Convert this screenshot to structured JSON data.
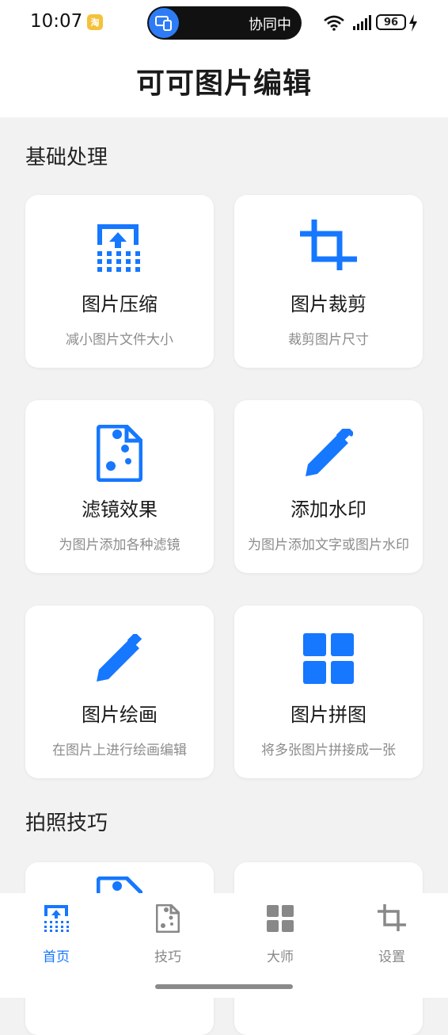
{
  "status_bar": {
    "time": "10:07",
    "app_badge": "淘",
    "pill_text": "协同中",
    "battery": "96",
    "icons": [
      "screen-share-icon",
      "wifi-icon",
      "signal-icon",
      "charging-icon"
    ]
  },
  "header": {
    "title": "可可图片编辑"
  },
  "sections": [
    {
      "title": "基础处理",
      "cards": [
        {
          "label": "图片压缩",
          "desc": "减小图片文件大小",
          "icon": "compress-icon"
        },
        {
          "label": "图片裁剪",
          "desc": "裁剪图片尺寸",
          "icon": "crop-icon"
        },
        {
          "label": "滤镜效果",
          "desc": "为图片添加各种滤镜",
          "icon": "filter-icon"
        },
        {
          "label": "添加水印",
          "desc": "为图片添加文字或图片水印",
          "icon": "pencil-icon"
        },
        {
          "label": "图片绘画",
          "desc": "在图片上进行绘画编辑",
          "icon": "pencil-icon"
        },
        {
          "label": "图片拼图",
          "desc": "将多张图片拼接成一张",
          "icon": "grid-icon"
        }
      ]
    },
    {
      "title": "拍照技巧"
    }
  ],
  "bottom_nav": [
    {
      "label": "首页",
      "icon": "home-icon",
      "active": true
    },
    {
      "label": "技巧",
      "icon": "document-icon",
      "active": false
    },
    {
      "label": "大师",
      "icon": "grid-icon",
      "active": false
    },
    {
      "label": "设置",
      "icon": "crop-icon",
      "active": false
    }
  ],
  "colors": {
    "accent": "#1677ff",
    "inactive": "#888888",
    "background": "#f2f2f2"
  }
}
